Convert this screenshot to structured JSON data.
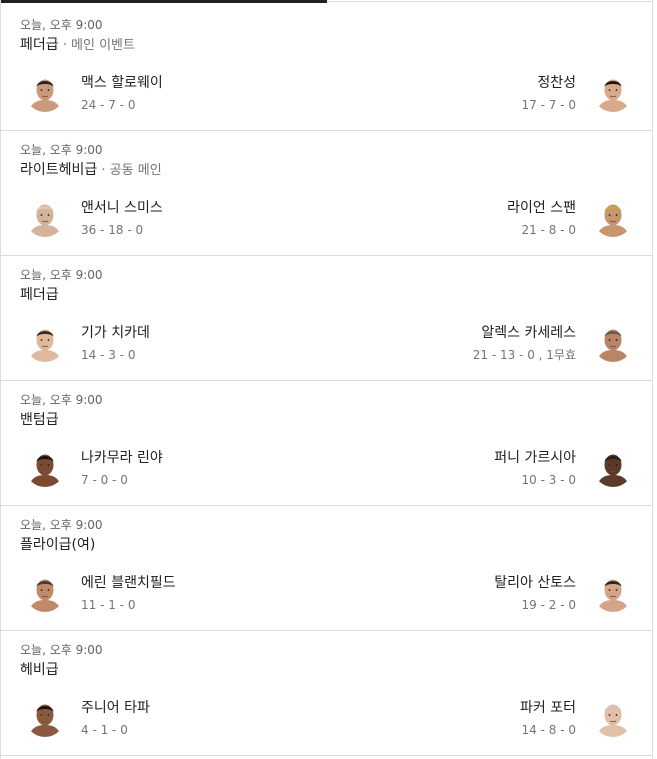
{
  "fights": [
    {
      "time": "오늘, 오후 9:00",
      "division": "페더급",
      "division_sub": "메인 이벤트",
      "left": {
        "name": "맥스 할로웨이",
        "record": "24 - 7 - 0",
        "avatar": "fighter-portrait-icon"
      },
      "right": {
        "name": "정찬성",
        "record": "17 - 7 - 0",
        "avatar": "fighter-portrait-icon"
      }
    },
    {
      "time": "오늘, 오후 9:00",
      "division": "라이트헤비급",
      "division_sub": "공동 메인",
      "left": {
        "name": "앤서니 스미스",
        "record": "36 - 18 - 0",
        "avatar": "fighter-portrait-icon"
      },
      "right": {
        "name": "라이언 스팬",
        "record": "21 - 8 - 0",
        "avatar": "fighter-portrait-icon"
      }
    },
    {
      "time": "오늘, 오후 9:00",
      "division": "페더급",
      "division_sub": "",
      "left": {
        "name": "기가 치카데",
        "record": "14 - 3 - 0",
        "avatar": "fighter-portrait-icon"
      },
      "right": {
        "name": "알렉스 카세레스",
        "record": "21 - 13 - 0 , 1무효",
        "avatar": "fighter-portrait-icon"
      }
    },
    {
      "time": "오늘, 오후 9:00",
      "division": "밴텀급",
      "division_sub": "",
      "left": {
        "name": "나카무라 린야",
        "record": "7 - 0 - 0",
        "avatar": "fighter-portrait-icon"
      },
      "right": {
        "name": "퍼니 가르시아",
        "record": "10 - 3 - 0",
        "avatar": "fighter-portrait-icon"
      }
    },
    {
      "time": "오늘, 오후 9:00",
      "division": "플라이급(여)",
      "division_sub": "",
      "left": {
        "name": "에린 블랜치필드",
        "record": "11 - 1 - 0",
        "avatar": "fighter-portrait-icon"
      },
      "right": {
        "name": "탈리아 산토스",
        "record": "19 - 2 - 0",
        "avatar": "fighter-portrait-icon"
      }
    },
    {
      "time": "오늘, 오후 9:00",
      "division": "헤비급",
      "division_sub": "",
      "left": {
        "name": "주니어 타파",
        "record": "4 - 1 - 0",
        "avatar": "fighter-portrait-icon"
      },
      "right": {
        "name": "파커 포터",
        "record": "14 - 8 - 0",
        "avatar": "fighter-portrait-icon"
      }
    }
  ],
  "separator": " · "
}
